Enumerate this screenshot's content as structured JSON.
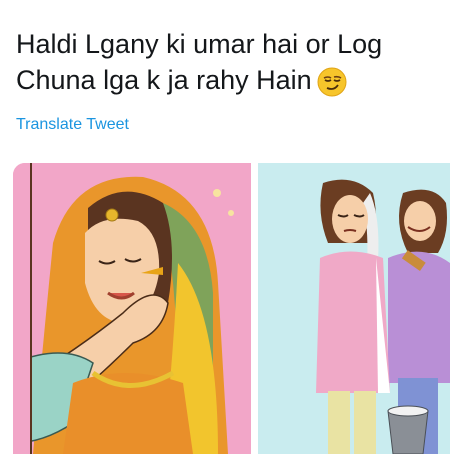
{
  "tweet": {
    "line1": "Haldi Lgany ki umar hai or Log",
    "line2": "Chuna lga k ja rahy Hain",
    "emoji": "smirking-face-icon",
    "translate_label": "Translate Tweet"
  },
  "media": {
    "left_panel": "bride-haldi-illustration",
    "right_panel": "girl-whitewash-illustration"
  },
  "colors": {
    "text": "#14171a",
    "link": "#1b95e0",
    "left_bg": "#f2a6c8",
    "right_bg": "#c9ecef"
  }
}
